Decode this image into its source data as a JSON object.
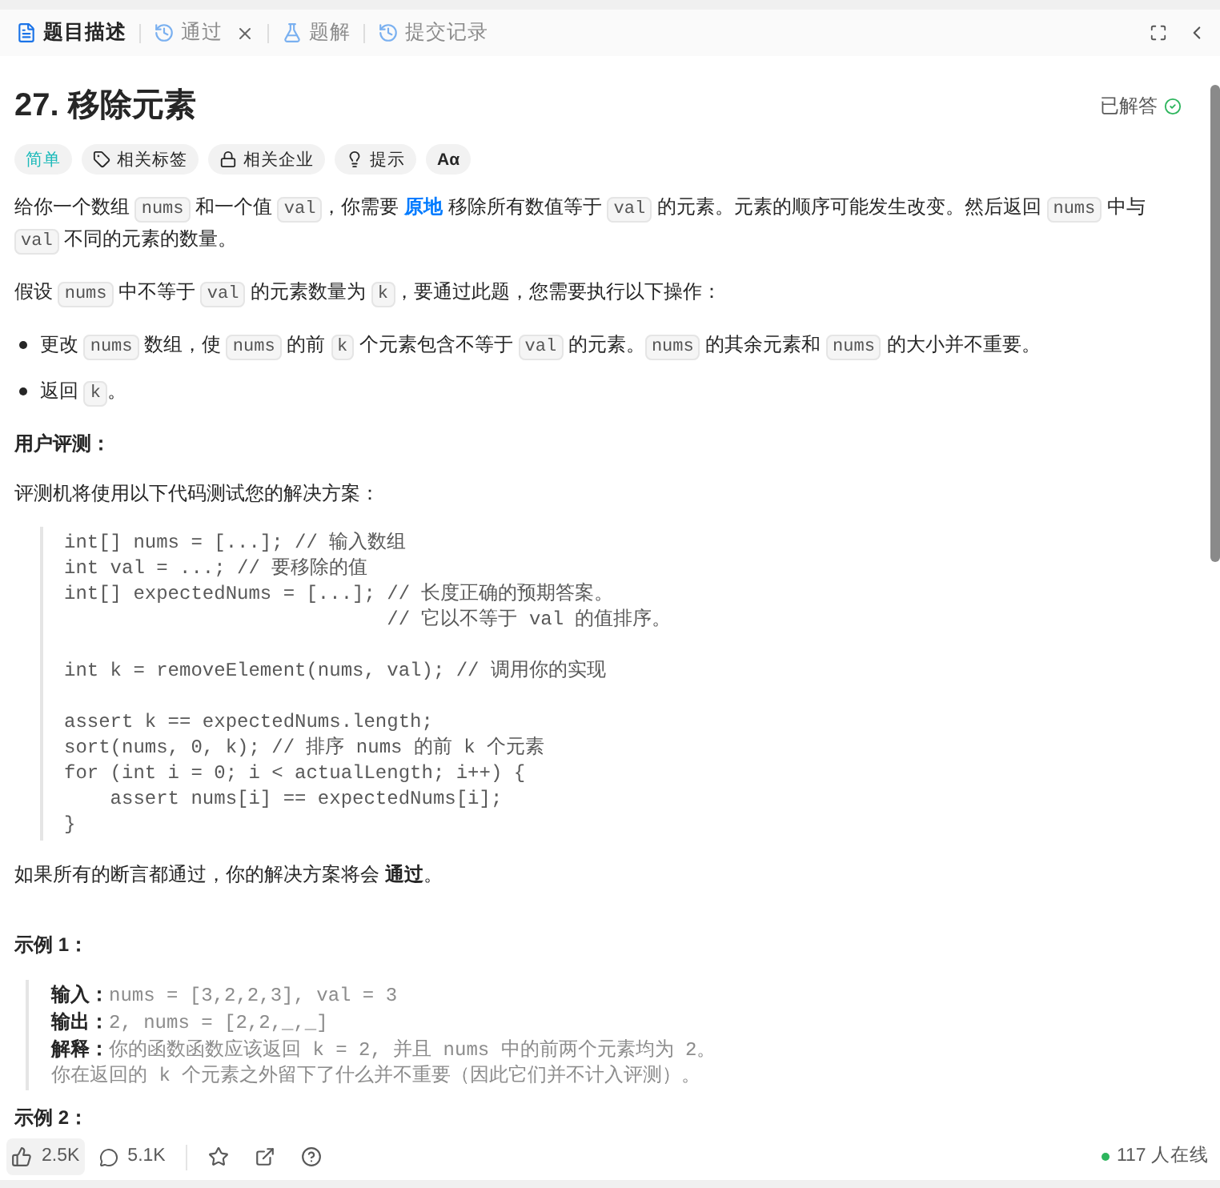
{
  "tabs": [
    {
      "label": "题目描述",
      "kind": "description",
      "selected": true,
      "closable": false
    },
    {
      "label": "通过",
      "kind": "result",
      "selected": false,
      "closable": true
    },
    {
      "label": "题解",
      "kind": "solutions",
      "selected": false,
      "closable": false
    },
    {
      "label": "提交记录",
      "kind": "submissions",
      "selected": false,
      "closable": false
    }
  ],
  "title": "27. 移除元素",
  "status": "已解答",
  "tags": [
    {
      "kind": "difficulty",
      "label": "简单"
    },
    {
      "kind": "tag",
      "label": "相关标签"
    },
    {
      "kind": "lock",
      "label": "相关企业"
    },
    {
      "kind": "bulb",
      "label": "提示"
    },
    {
      "kind": "translate",
      "label": "Aα"
    }
  ],
  "paragraphs": [
    [
      {
        "kind": "text",
        "text": "给你一个数组 "
      },
      {
        "kind": "code",
        "text": "nums"
      },
      {
        "kind": "text",
        "text": " 和一个值 "
      },
      {
        "kind": "code",
        "text": "val"
      },
      {
        "kind": "text",
        "text": "，你需要 "
      },
      {
        "kind": "link",
        "text": "原地"
      },
      {
        "kind": "text",
        "text": " 移除所有数值等于 "
      },
      {
        "kind": "code",
        "text": "val"
      },
      {
        "kind": "text",
        "text": " 的元素。元素的顺序可能发生改变。然后返回 "
      },
      {
        "kind": "code",
        "text": "nums"
      },
      {
        "kind": "text",
        "text": " 中与 "
      },
      {
        "kind": "code",
        "text": "val"
      },
      {
        "kind": "text",
        "text": " 不同的元素的数量。"
      }
    ],
    [
      {
        "kind": "text",
        "text": "假设 "
      },
      {
        "kind": "code",
        "text": "nums"
      },
      {
        "kind": "text",
        "text": " 中不等于 "
      },
      {
        "kind": "code",
        "text": "val"
      },
      {
        "kind": "text",
        "text": " 的元素数量为 "
      },
      {
        "kind": "code",
        "text": "k"
      },
      {
        "kind": "text",
        "text": "，要通过此题，您需要执行以下操作："
      }
    ]
  ],
  "bullets": [
    [
      {
        "kind": "text",
        "text": "更改 "
      },
      {
        "kind": "code",
        "text": "nums"
      },
      {
        "kind": "text",
        "text": " 数组，使 "
      },
      {
        "kind": "code",
        "text": "nums"
      },
      {
        "kind": "text",
        "text": " 的前 "
      },
      {
        "kind": "code",
        "text": "k"
      },
      {
        "kind": "text",
        "text": " 个元素包含不等于 "
      },
      {
        "kind": "code",
        "text": "val"
      },
      {
        "kind": "text",
        "text": " 的元素。"
      },
      {
        "kind": "code",
        "text": "nums"
      },
      {
        "kind": "text",
        "text": " 的其余元素和 "
      },
      {
        "kind": "code",
        "text": "nums"
      },
      {
        "kind": "text",
        "text": " 的大小并不重要。"
      }
    ],
    [
      {
        "kind": "text",
        "text": "返回 "
      },
      {
        "kind": "code",
        "text": "k"
      },
      {
        "kind": "text",
        "text": "。"
      }
    ]
  ],
  "judge_heading": "用户评测：",
  "judge_intro": "评测机将使用以下代码测试您的解决方案：",
  "code_blocks": [
    [
      "int[] nums = [...]; // 输入数组",
      "int val = ...; // 要移除的值",
      "int[] expectedNums = [...]; // 长度正确的预期答案。",
      "                            // 它以不等于 val 的值排序。"
    ],
    [
      "int k = removeElement(nums, val); // 调用你的实现"
    ],
    [
      "assert k == expectedNums.length;",
      "sort(nums, 0, k); // 排序 nums 的前 k 个元素",
      "for (int i = 0; i < actualLength; i++) {",
      "    assert nums[i] == expectedNums[i];",
      "}"
    ]
  ],
  "pass_note": [
    {
      "kind": "text",
      "text": "如果所有的断言都通过，你的解决方案将会 "
    },
    {
      "kind": "bold",
      "text": "通过"
    },
    {
      "kind": "text",
      "text": "。"
    }
  ],
  "examples": [
    {
      "heading": "示例 1：",
      "lines": [
        {
          "label": "输入：",
          "value": "nums = [3,2,2,3], val = 3"
        },
        {
          "label": "输出：",
          "value": "2, nums = [2,2,_,_]"
        },
        {
          "label": "解释：",
          "value": "你的函数函数应该返回 k = 2, 并且 nums 中的前两个元素均为 2。"
        },
        {
          "value": "你在返回的 k 个元素之外留下了什么并不重要（因此它们并不计入评测）。"
        }
      ]
    },
    {
      "heading": "示例 2："
    }
  ],
  "footer": {
    "likes": "2.5K",
    "comments": "5.1K",
    "online": "117 人在线"
  }
}
